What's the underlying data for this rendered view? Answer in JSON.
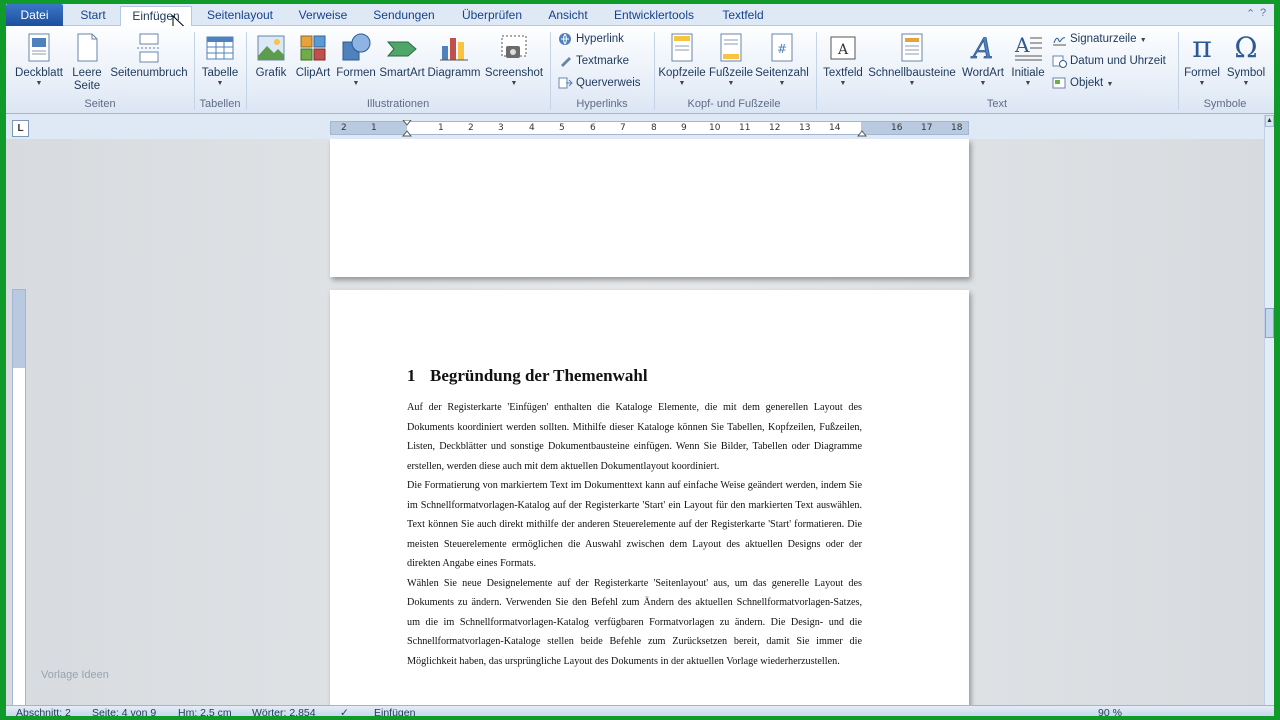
{
  "tabs": {
    "file": "Datei",
    "items": [
      "Start",
      "Einfügen",
      "Seitenlayout",
      "Verweise",
      "Sendungen",
      "Überprüfen",
      "Ansicht",
      "Entwicklertools",
      "Textfeld"
    ],
    "active": "Einfügen"
  },
  "ribbon": {
    "seiten": {
      "label": "Seiten",
      "deckblatt": "Deckblatt",
      "leere_seite_1": "Leere",
      "leere_seite_2": "Seite",
      "seitenumbruch": "Seitenumbruch"
    },
    "tabellen": {
      "label": "Tabellen",
      "tabelle": "Tabelle"
    },
    "illustrationen": {
      "label": "Illustrationen",
      "grafik": "Grafik",
      "clipart": "ClipArt",
      "formen": "Formen",
      "smartart": "SmartArt",
      "diagramm": "Diagramm",
      "screenshot": "Screenshot"
    },
    "hyperlinks": {
      "label": "Hyperlinks",
      "hyperlink": "Hyperlink",
      "textmarke": "Textmarke",
      "querverweis": "Querverweis"
    },
    "kopf_fuss": {
      "label": "Kopf- und Fußzeile",
      "kopfzeile": "Kopfzeile",
      "fusszeile": "Fußzeile",
      "seitenzahl": "Seitenzahl"
    },
    "text": {
      "label": "Text",
      "textfeld": "Textfeld",
      "schnellbausteine": "Schnellbausteine",
      "wordart": "WordArt",
      "initiale": "Initiale",
      "signaturzeile": "Signaturzeile",
      "datum": "Datum und Uhrzeit",
      "objekt": "Objekt"
    },
    "symbole": {
      "label": "Symbole",
      "formel": "Formel",
      "symbol": "Symbol"
    }
  },
  "ruler": {
    "corner": "L",
    "ticks": [
      "2",
      "1",
      "1",
      "2",
      "3",
      "4",
      "5",
      "6",
      "7",
      "8",
      "9",
      "10",
      "11",
      "12",
      "13",
      "14",
      "16",
      "17",
      "18"
    ]
  },
  "document": {
    "heading_number": "1",
    "heading_text": "Begründung der Themenwahl",
    "paragraphs": [
      "Auf der Registerkarte 'Einfügen' enthalten die Kataloge Elemente, die mit dem generellen Layout des Dokuments koordiniert werden sollten. Mithilfe dieser Kataloge können Sie Tabellen, Kopfzeilen, Fußzeilen, Listen, Deckblätter und sonstige Dokumentbausteine einfügen. Wenn Sie Bilder, Tabellen oder Diagramme erstellen, werden diese auch mit dem aktuellen Dokumentlayout koordiniert.",
      "Die Formatierung von markiertem Text im Dokumenttext kann auf einfache Weise geändert werden, indem Sie im Schnellformatvorlagen-Katalog auf der Registerkarte 'Start' ein Layout für den markierten Text auswählen. Text können Sie auch direkt mithilfe der anderen Steuerelemente auf der Registerkarte 'Start' formatieren. Die meisten Steuerelemente ermöglichen die Auswahl zwischen dem Layout des aktuellen Designs oder der direkten Angabe eines Formats.",
      "Wählen Sie neue Designelemente auf der Registerkarte 'Seitenlayout' aus, um das generelle Layout des Dokuments zu ändern. Verwenden Sie den Befehl zum Ändern des aktuellen Schnellformatvorlagen-Satzes, um die im Schnellformatvorlagen-Katalog verfügbaren Formatvorlagen zu ändern. Die Design- und die Schnellformatvorlagen-Kataloge stellen beide Befehle zum Zurücksetzen bereit, damit Sie immer die Möglichkeit haben, das ursprüngliche Layout des Dokuments in der aktuellen Vorlage wiederherzustellen."
    ]
  },
  "watermark": "Vorlage Ideen",
  "statusbar": {
    "abschnitt": "Abschnitt: 2",
    "seite": "Seite: 4 von 9",
    "position": "Hm: 2,5 cm",
    "woerter": "Wörter: 2.854",
    "modus": "Einfügen",
    "zoom": "90 %"
  },
  "colors": {
    "frame": "#0f9a2a",
    "file_tab": "#2b579a",
    "ribbon_text": "#1e395b"
  }
}
